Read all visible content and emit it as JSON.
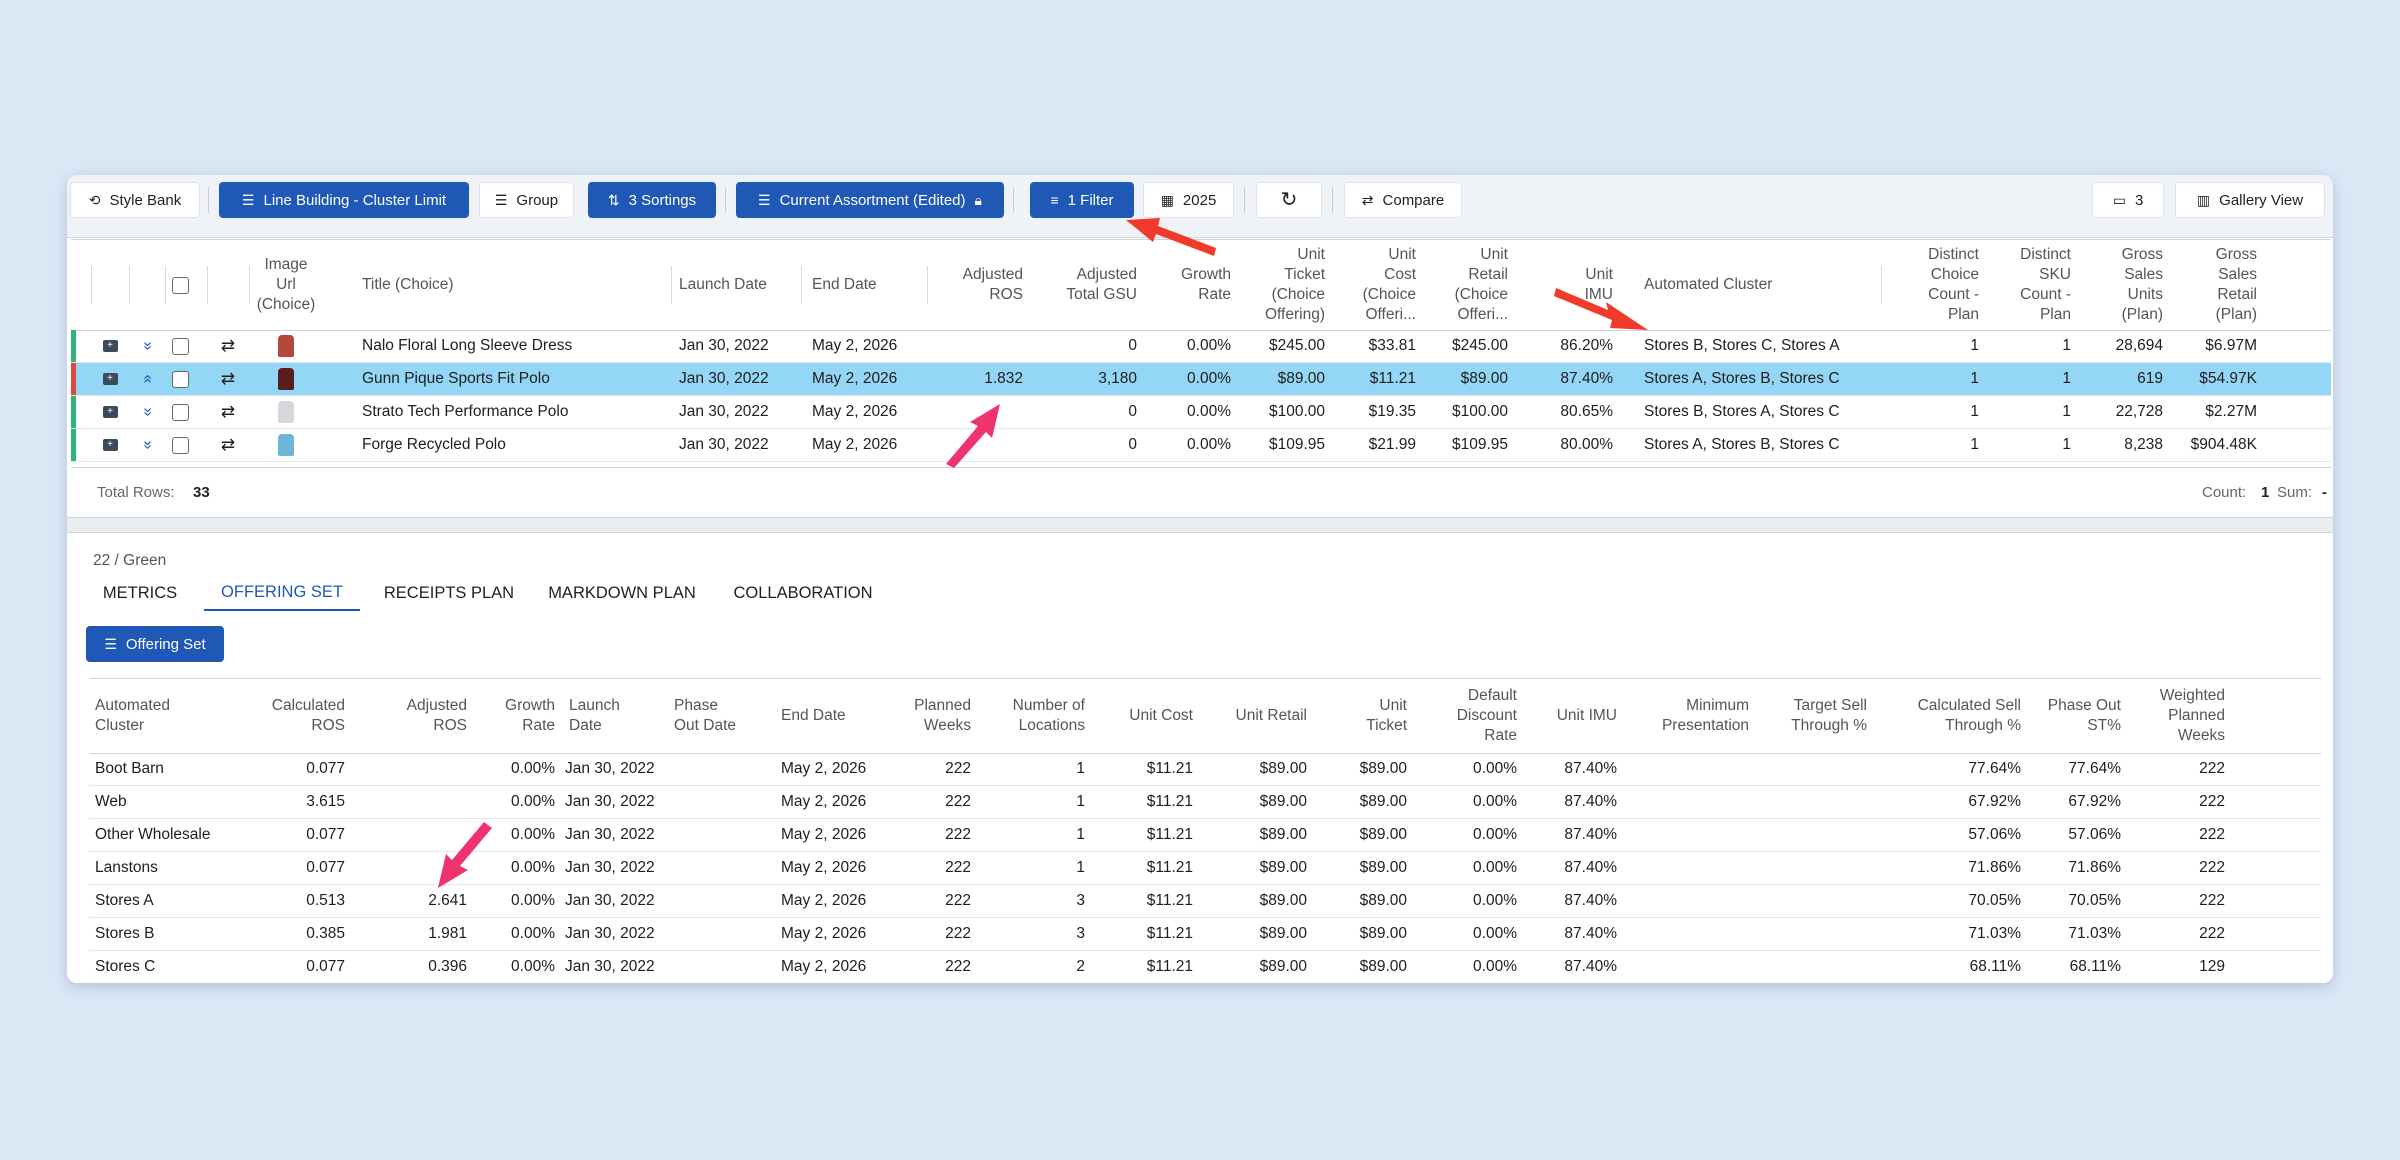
{
  "toolbar": {
    "style_bank": "Style Bank",
    "line_building": "Line Building - Cluster Limit",
    "group": "Group",
    "sortings": "3 Sortings",
    "assortment": "Current Assortment (Edited)",
    "filter": "1 Filter",
    "year": "2025",
    "compare": "Compare",
    "count_badge": "3",
    "gallery_view": "Gallery View"
  },
  "top_grid": {
    "headers": {
      "image": "Image\nUrl\n(Choice)",
      "title": "Title (Choice)",
      "launch": "Launch Date",
      "end": "End Date",
      "adj_ros": "Adjusted\nROS",
      "adj_gsu": "Adjusted\nTotal GSU",
      "growth": "Growth\nRate",
      "unit_ticket": "Unit\nTicket\n(Choice\nOffering)",
      "unit_cost": "Unit\nCost\n(Choice\nOfferi...",
      "unit_retail": "Unit\nRetail\n(Choice\nOfferi...",
      "unit_imu": "Unit\nIMU",
      "cluster": "Automated Cluster",
      "choice_count": "Distinct\nChoice\nCount -\nPlan",
      "sku_count": "Distinct\nSKU\nCount -\nPlan",
      "gross_units": "Gross\nSales\nUnits\n(Plan)",
      "gross_retail": "Gross\nSales\nRetail\n(Plan)"
    },
    "rows": [
      {
        "title": "Nalo Floral Long Sleeve Dress",
        "launch": "Jan 30, 2022",
        "end": "May 2, 2026",
        "adj_ros": "",
        "adj_gsu": "0",
        "growth": "0.00%",
        "ticket": "$245.00",
        "cost": "$33.81",
        "retail": "$245.00",
        "imu": "86.20%",
        "cluster": "Stores B, Stores C, Stores A",
        "choice": "1",
        "sku": "1",
        "units": "28,694",
        "gross": "$6.97M",
        "bar": "#2bb673",
        "shirt": "#b5483c",
        "expand": "»"
      },
      {
        "title": "Gunn Pique Sports Fit Polo",
        "launch": "Jan 30, 2022",
        "end": "May 2, 2026",
        "adj_ros": "1.832",
        "adj_gsu": "3,180",
        "growth": "0.00%",
        "ticket": "$89.00",
        "cost": "$11.21",
        "retail": "$89.00",
        "imu": "87.40%",
        "cluster": "Stores A, Stores B, Stores C",
        "choice": "1",
        "sku": "1",
        "units": "619",
        "gross": "$54.97K",
        "bar": "#e04646",
        "shirt": "#5a1d1d",
        "expand": "«"
      },
      {
        "title": "Strato Tech Performance Polo",
        "launch": "Jan 30, 2022",
        "end": "May 2, 2026",
        "adj_ros": "",
        "adj_gsu": "0",
        "growth": "0.00%",
        "ticket": "$100.00",
        "cost": "$19.35",
        "retail": "$100.00",
        "imu": "80.65%",
        "cluster": "Stores B, Stores A, Stores C",
        "choice": "1",
        "sku": "1",
        "units": "22,728",
        "gross": "$2.27M",
        "bar": "#2bb673",
        "shirt": "#d4d7db",
        "expand": "»"
      },
      {
        "title": "Forge Recycled Polo",
        "launch": "Jan 30, 2022",
        "end": "May 2, 2026",
        "adj_ros": "",
        "adj_gsu": "0",
        "growth": "0.00%",
        "ticket": "$109.95",
        "cost": "$21.99",
        "retail": "$109.95",
        "imu": "80.00%",
        "cluster": "Stores A, Stores B, Stores C",
        "choice": "1",
        "sku": "1",
        "units": "8,238",
        "gross": "$904.48K",
        "bar": "#2bb673",
        "shirt": "#6cb6d8",
        "expand": "»"
      }
    ],
    "footer": {
      "total_label": "Total Rows:",
      "total_value": "33",
      "count_label": "Count:",
      "count_value": "1",
      "sum_label": "Sum:",
      "sum_value": "-"
    }
  },
  "detail": {
    "subtitle": "22 / Green",
    "tabs": [
      "METRICS",
      "OFFERING SET",
      "RECEIPTS PLAN",
      "MARKDOWN PLAN",
      "COLLABORATION"
    ],
    "active_tab": "OFFERING SET",
    "offering_button": "Offering Set",
    "headers": {
      "cluster": "Automated\nCluster",
      "calc_ros": "Calculated\nROS",
      "adj_ros": "Adjusted\nROS",
      "growth": "Growth\nRate",
      "launch": "Launch\nDate",
      "phase_out": "Phase\nOut Date",
      "end": "End Date",
      "planned_weeks": "Planned\nWeeks",
      "locations": "Number of\nLocations",
      "unit_cost": "Unit Cost",
      "unit_retail": "Unit Retail",
      "unit_ticket": "Unit\nTicket",
      "discount": "Default\nDiscount\nRate",
      "imu": "Unit IMU",
      "min_pres": "Minimum\nPresentation",
      "target_st": "Target Sell\nThrough %",
      "calc_st": "Calculated Sell\nThrough %",
      "phase_st": "Phase Out\nST%",
      "weighted": "Weighted\nPlanned\nWeeks"
    },
    "rows": [
      {
        "cluster": "Boot Barn",
        "calc_ros": "0.077",
        "adj_ros": "",
        "growth": "0.00%",
        "launch": "Jan 30, 2022",
        "phase_out": "",
        "end": "May 2, 2026",
        "weeks": "222",
        "locations": "1",
        "cost": "$11.21",
        "retail": "$89.00",
        "ticket": "$89.00",
        "discount": "0.00%",
        "imu": "87.40%",
        "min_pres": "",
        "target_st": "",
        "calc_st": "77.64%",
        "phase_st": "77.64%",
        "weighted": "222"
      },
      {
        "cluster": "Web",
        "calc_ros": "3.615",
        "adj_ros": "",
        "growth": "0.00%",
        "launch": "Jan 30, 2022",
        "phase_out": "",
        "end": "May 2, 2026",
        "weeks": "222",
        "locations": "1",
        "cost": "$11.21",
        "retail": "$89.00",
        "ticket": "$89.00",
        "discount": "0.00%",
        "imu": "87.40%",
        "min_pres": "",
        "target_st": "",
        "calc_st": "67.92%",
        "phase_st": "67.92%",
        "weighted": "222"
      },
      {
        "cluster": "Other Wholesale",
        "calc_ros": "0.077",
        "adj_ros": "",
        "growth": "0.00%",
        "launch": "Jan 30, 2022",
        "phase_out": "",
        "end": "May 2, 2026",
        "weeks": "222",
        "locations": "1",
        "cost": "$11.21",
        "retail": "$89.00",
        "ticket": "$89.00",
        "discount": "0.00%",
        "imu": "87.40%",
        "min_pres": "",
        "target_st": "",
        "calc_st": "57.06%",
        "phase_st": "57.06%",
        "weighted": "222"
      },
      {
        "cluster": "Lanstons",
        "calc_ros": "0.077",
        "adj_ros": "",
        "growth": "0.00%",
        "launch": "Jan 30, 2022",
        "phase_out": "",
        "end": "May 2, 2026",
        "weeks": "222",
        "locations": "1",
        "cost": "$11.21",
        "retail": "$89.00",
        "ticket": "$89.00",
        "discount": "0.00%",
        "imu": "87.40%",
        "min_pres": "",
        "target_st": "",
        "calc_st": "71.86%",
        "phase_st": "71.86%",
        "weighted": "222"
      },
      {
        "cluster": "Stores A",
        "calc_ros": "0.513",
        "adj_ros": "2.641",
        "growth": "0.00%",
        "launch": "Jan 30, 2022",
        "phase_out": "",
        "end": "May 2, 2026",
        "weeks": "222",
        "locations": "3",
        "cost": "$11.21",
        "retail": "$89.00",
        "ticket": "$89.00",
        "discount": "0.00%",
        "imu": "87.40%",
        "min_pres": "",
        "target_st": "",
        "calc_st": "70.05%",
        "phase_st": "70.05%",
        "weighted": "222"
      },
      {
        "cluster": "Stores B",
        "calc_ros": "0.385",
        "adj_ros": "1.981",
        "growth": "0.00%",
        "launch": "Jan 30, 2022",
        "phase_out": "",
        "end": "May 2, 2026",
        "weeks": "222",
        "locations": "3",
        "cost": "$11.21",
        "retail": "$89.00",
        "ticket": "$89.00",
        "discount": "0.00%",
        "imu": "87.40%",
        "min_pres": "",
        "target_st": "",
        "calc_st": "71.03%",
        "phase_st": "71.03%",
        "weighted": "222"
      },
      {
        "cluster": "Stores C",
        "calc_ros": "0.077",
        "adj_ros": "0.396",
        "growth": "0.00%",
        "launch": "Jan 30, 2022",
        "phase_out": "",
        "end": "May 2, 2026",
        "weeks": "222",
        "locations": "2",
        "cost": "$11.21",
        "retail": "$89.00",
        "ticket": "$89.00",
        "discount": "0.00%",
        "imu": "87.40%",
        "min_pres": "",
        "target_st": "",
        "calc_st": "68.11%",
        "phase_st": "68.11%",
        "weighted": "129"
      }
    ]
  },
  "colors": {
    "accent": "#1f58b5",
    "selected_row": "#93d6f5",
    "annotation_red": "#f03a2a",
    "annotation_pink": "#f0336e"
  }
}
